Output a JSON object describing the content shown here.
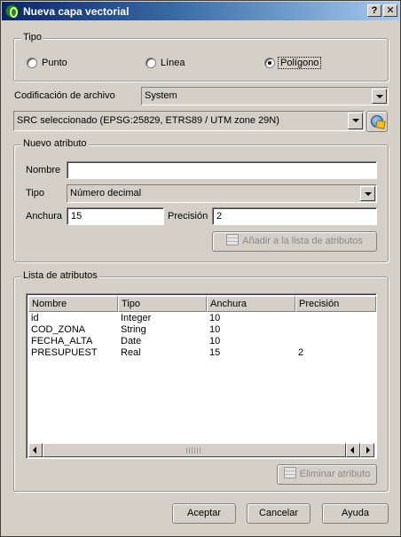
{
  "window": {
    "title": "Nueva capa vectorial",
    "help_glyph": "?",
    "close_glyph": "✕"
  },
  "tipo": {
    "title": "Tipo",
    "options": [
      "Punto",
      "Línea",
      "Polígono"
    ],
    "selected": "Polígono"
  },
  "encoding": {
    "label": "Codificación de archivo",
    "value": "System"
  },
  "crs": {
    "value": "SRC seleccionado (EPSG:25829, ETRS89 / UTM zone 29N)"
  },
  "nuevo_atributo": {
    "title": "Nuevo atributo",
    "nombre_label": "Nombre",
    "nombre_value": "",
    "tipo_label": "Tipo",
    "tipo_value": "Número decimal",
    "anchura_label": "Anchura",
    "anchura_value": "15",
    "precision_label": "Precisión",
    "precision_value": "2",
    "add_button": "Añadir a la lista de atributos"
  },
  "lista": {
    "title": "Lista de atributos",
    "columns": [
      "Nombre",
      "Tipo",
      "Anchura",
      "Precisión"
    ],
    "rows": [
      [
        "id",
        "Integer",
        "10",
        ""
      ],
      [
        "COD_ZONA",
        "String",
        "10",
        ""
      ],
      [
        "FECHA_ALTA",
        "Date",
        "10",
        ""
      ],
      [
        "PRESUPUEST",
        "Real",
        "15",
        "2"
      ]
    ],
    "remove_button": "Eliminar atributo"
  },
  "footer": {
    "accept": "Aceptar",
    "cancel": "Cancelar",
    "help": "Ayuda"
  }
}
